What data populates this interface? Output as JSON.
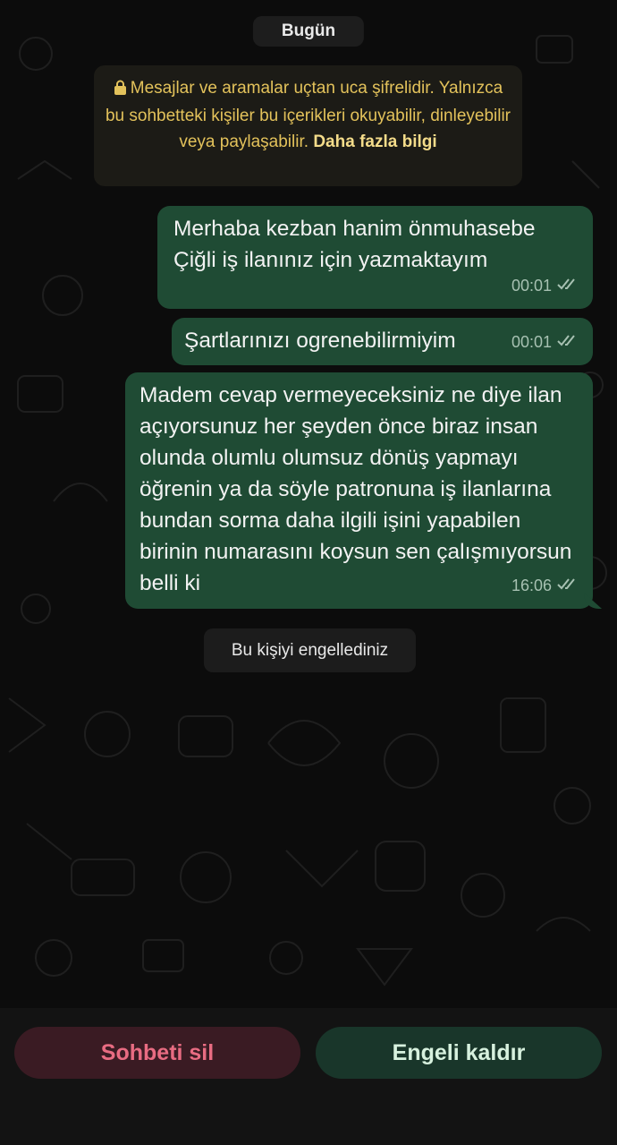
{
  "chat": {
    "date_label": "Bugün",
    "encryption_notice": {
      "text": "Mesajlar ve aramalar uçtan uca şifrelidir. Yalnızca bu sohbetteki kişiler bu içerikleri okuyabilir, dinleyebilir veya paylaşabilir.",
      "link": "Daha fazla bilgi",
      "icon": "lock-icon"
    },
    "messages": [
      {
        "text": "Merhaba kezban hanim önmuhasebe Çiğli iş ilanınız için yazmaktayım",
        "time": "00:01",
        "status": "read-ticks-icon"
      },
      {
        "text": "Şartlarınızı ogrenebilirmiyim",
        "time": "00:01",
        "status": "read-ticks-icon"
      },
      {
        "text": "Madem cevap vermeyeceksiniz ne diye ilan açıyorsunuz her şeyden önce biraz insan olunda olumlu olumsuz dönüş yapmayı öğrenin ya da söyle patronuna iş ilanlarına bundan sorma daha ilgili işini yapabilen birinin numarasını koysun sen çalışmıyorsun belli ki",
        "time": "16:06",
        "status": "read-ticks-icon"
      }
    ],
    "system_message": "Bu kişiyi engellediniz"
  },
  "actions": {
    "delete_label": "Sohbeti sil",
    "unblock_label": "Engeli kaldır"
  },
  "colors": {
    "outgoing_bubble": "#1f4b34",
    "notice_text": "#e3c25b",
    "delete_text": "#e86c82",
    "unblock_text": "#d7f1de"
  }
}
